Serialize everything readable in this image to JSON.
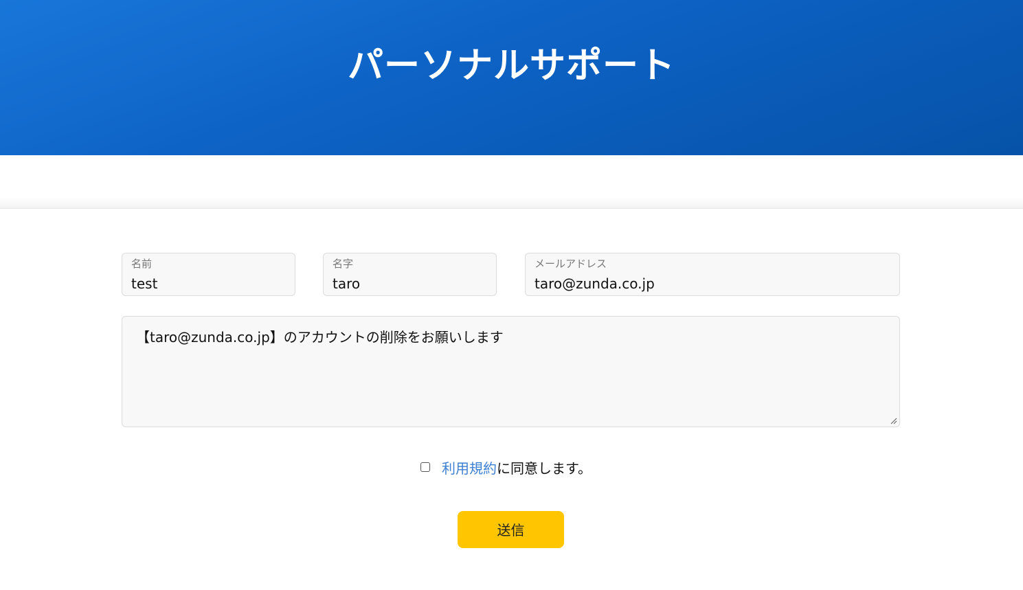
{
  "header": {
    "title": "パーソナルサポート"
  },
  "form": {
    "first_name": {
      "label": "名前",
      "value": "test"
    },
    "last_name": {
      "label": "名字",
      "value": "taro"
    },
    "email": {
      "label": "メールアドレス",
      "value": "taro@zunda.co.jp"
    },
    "message": {
      "value": "【taro@zunda.co.jp】のアカウントの削除をお願いします"
    },
    "agree": {
      "checked": false,
      "link_text": "利用規約",
      "suffix_text": "に同意します。"
    },
    "submit_label": "送信"
  },
  "colors": {
    "header_gradient_start": "#1976d9",
    "header_gradient_end": "#0652a8",
    "link": "#3d7fd1",
    "submit_button": "#ffc600",
    "field_background": "#f8f8f8"
  },
  "icons": {
    "resize_handle": "resize-grip-icon"
  }
}
